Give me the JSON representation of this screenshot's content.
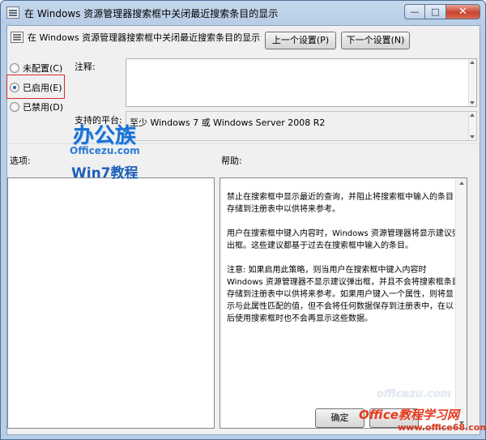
{
  "window": {
    "title": "在 Windows 资源管理器搜索框中关闭最近搜索条目的显示",
    "minimize_glyph": "—",
    "maximize_glyph": "□",
    "close_glyph": "✕"
  },
  "header": {
    "policy_title": "在 Windows 资源管理器搜索框中关闭最近搜索条目的显示",
    "prev_button": "上一个设置(P)",
    "next_button": "下一个设置(N)"
  },
  "state": {
    "options": [
      {
        "label": "未配置(C)",
        "checked": false
      },
      {
        "label": "已启用(E)",
        "checked": true
      },
      {
        "label": "已禁用(D)",
        "checked": false
      }
    ]
  },
  "comment": {
    "label": "注释:",
    "value": ""
  },
  "platform": {
    "label": "支持的平台:",
    "value": "至少 Windows 7 或 Windows Server 2008 R2"
  },
  "panels": {
    "options_label": "选项:",
    "help_label": "帮助:"
  },
  "help": {
    "paragraphs": [
      "禁止在搜索框中显示最近的查询，并阻止将搜索框中输入的条目存储到注册表中以供将来参考。",
      "用户在搜索框中键入内容时，Windows 资源管理器将显示建议弹出框。这些建议都基于过去在搜索框中输入的条目。",
      "注意: 如果启用此策略，则当用户在搜索框中键入内容时 Windows 资源管理器不显示建议弹出框，并且不会将搜索框条目存储到注册表中以供将来参考。如果用户键入一个属性，则将显示与此属性匹配的值，但不会将任何数据保存到注册表中，在以后使用搜索框时也不会再显示这些数据。"
    ]
  },
  "footer": {
    "ok_button": "确定"
  },
  "overlay": {
    "logo_big": "办公族",
    "logo_url": "Officezu.com",
    "logo_win": "Win7教程",
    "wm_ghost": "officezu.com",
    "wm_brand": "Office教程学习网",
    "wm_url": "www.office68.com"
  },
  "colors": {
    "highlight": "#d62b2b",
    "title_bar": "#b8cde6"
  }
}
